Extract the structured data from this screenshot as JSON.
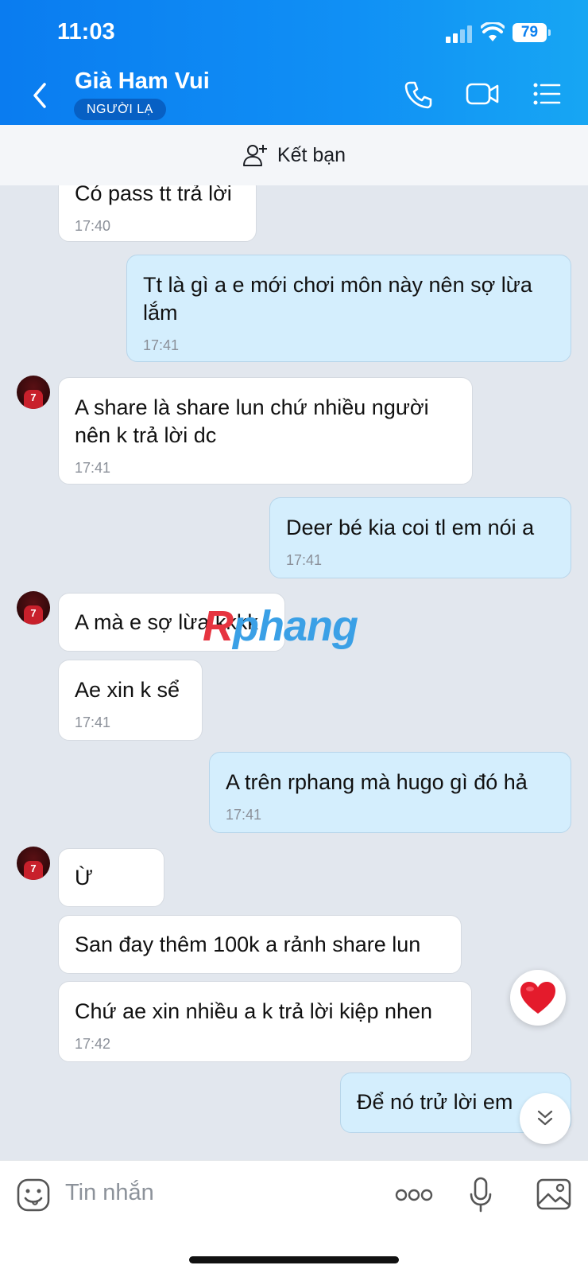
{
  "status": {
    "time": "11:03",
    "battery": "79"
  },
  "header": {
    "title": "Già Ham Vui",
    "tag": "NGƯỜI LẠ"
  },
  "friend_bar": {
    "label": "Kết bạn"
  },
  "avatar_text": "7",
  "messages": [
    {
      "text": "Có pass tt trả lời",
      "time": "17:40"
    },
    {
      "text": "Tt là gì a e mới chơi môn này nên sợ lừa lắm",
      "time": "17:41"
    },
    {
      "text": "A share là share lun chứ nhiều người nên k trả lời dc",
      "time": "17:41"
    },
    {
      "text": "Deer bé kia coi tl em nói a",
      "time": "17:41"
    },
    {
      "text": "A mà e sợ lừa kkkk"
    },
    {
      "text": "Ae xin k sể",
      "time": "17:41"
    },
    {
      "text": "A trên rphang mà hugo gì đó hả",
      "time": "17:41"
    },
    {
      "text": "Ừ"
    },
    {
      "text": "San đay thêm 100k a rảnh share lun"
    },
    {
      "text": "Chứ ae xin nhiều a k trả lời kiệp nhen",
      "time": "17:42"
    },
    {
      "text": "Để nó trử lời em"
    }
  ],
  "watermark": {
    "part1": "R",
    "part2": "phang"
  },
  "input": {
    "placeholder": "Tin nhắn"
  }
}
